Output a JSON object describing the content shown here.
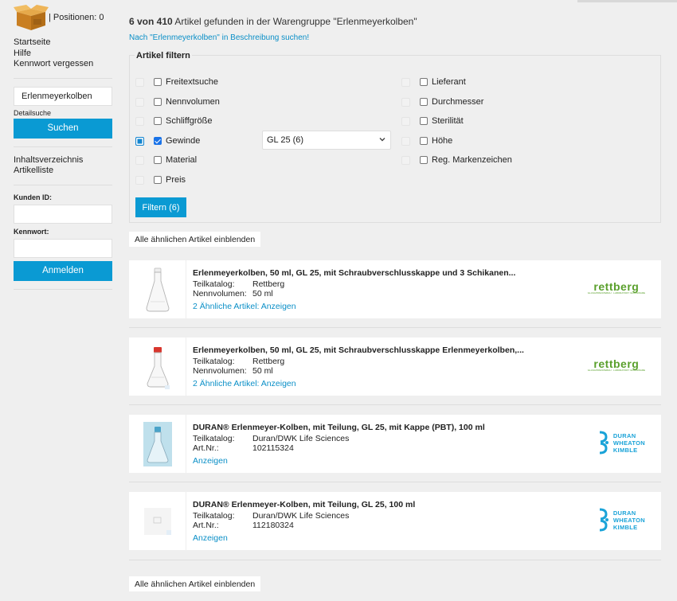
{
  "header": {
    "cart_positions": "| Positionen: 0"
  },
  "sidebar": {
    "links": [
      "Startseite",
      "Hilfe",
      "Kennwort vergessen"
    ],
    "search_value": "Erlenmeyerkolben",
    "detail_search": "Detailsuche",
    "search_button": "Suchen",
    "nav_links": [
      "Inhaltsverzeichnis",
      "Artikelliste"
    ],
    "customer_id_label": "Kunden ID:",
    "password_label": "Kennwort:",
    "login_button": "Anmelden"
  },
  "main": {
    "result_count": "6 von 410",
    "result_text": " Artikel gefunden in der Warengruppe \"Erlenmeyerkolben\"",
    "search_description_link": "Nach \"Erlenmeyerkolben\" in Beschreibung suchen!",
    "filter": {
      "legend": "Artikel filtern",
      "left_options": [
        {
          "label": "Freitextsuche",
          "checked": false
        },
        {
          "label": "Nennvolumen",
          "checked": false
        },
        {
          "label": "Schliffgröße",
          "checked": false
        },
        {
          "label": "Gewinde",
          "checked": true
        },
        {
          "label": "Material",
          "checked": false
        },
        {
          "label": "Preis",
          "checked": false
        }
      ],
      "right_options": [
        {
          "label": "Lieferant",
          "checked": false
        },
        {
          "label": "Durchmesser",
          "checked": false
        },
        {
          "label": "Sterilität",
          "checked": false
        },
        {
          "label": "Höhe",
          "checked": false
        },
        {
          "label": "Reg. Markenzeichen",
          "checked": false
        }
      ],
      "gewinde_selected": "GL 25 (6)",
      "filter_button": "Filtern (6)"
    },
    "show_similar": "Alle ähnlichen Artikel einblenden",
    "products": [
      {
        "title": "Erlenmeyerkolben, 50 ml, GL 25, mit Schraubverschlusskappe und 3 Schikanen...",
        "fields": [
          [
            "Teilkatalog:",
            "Rettberg"
          ],
          [
            "Nennvolumen:",
            "50 ml"
          ]
        ],
        "link": "2 Ähnliche Artikel: Anzeigen",
        "brand": "rettberg",
        "brand_sub": "GLASAPPARATEBAU · LABORATORY GLASSWARE"
      },
      {
        "title": "Erlenmeyerkolben, 50 ml, GL 25, mit Schraubverschlusskappe Erlenmeyerkolben,...",
        "fields": [
          [
            "Teilkatalog:",
            "Rettberg"
          ],
          [
            "Nennvolumen:",
            "50 ml"
          ]
        ],
        "link": "2 Ähnliche Artikel: Anzeigen",
        "brand": "rettberg",
        "brand_sub": "GLASAPPARATEBAU · LABORATORY GLASSWARE"
      },
      {
        "title": "DURAN® Erlenmeyer-Kolben, mit Teilung, GL 25, mit Kappe (PBT), 100 ml",
        "fields": [
          [
            "Teilkatalog:",
            "Duran/DWK Life Sciences"
          ],
          [
            "Art.Nr.:",
            "102115324"
          ]
        ],
        "link": "Anzeigen",
        "brand": "duran",
        "brand_lines": [
          "DURAN",
          "WHEATON",
          "KIMBLE"
        ]
      },
      {
        "title": "DURAN® Erlenmeyer-Kolben, mit Teilung, GL 25, 100 ml",
        "fields": [
          [
            "Teilkatalog:",
            "Duran/DWK Life Sciences"
          ],
          [
            "Art.Nr.:",
            "112180324"
          ]
        ],
        "link": "Anzeigen",
        "brand": "duran",
        "brand_lines": [
          "DURAN",
          "WHEATON",
          "KIMBLE"
        ]
      }
    ]
  }
}
